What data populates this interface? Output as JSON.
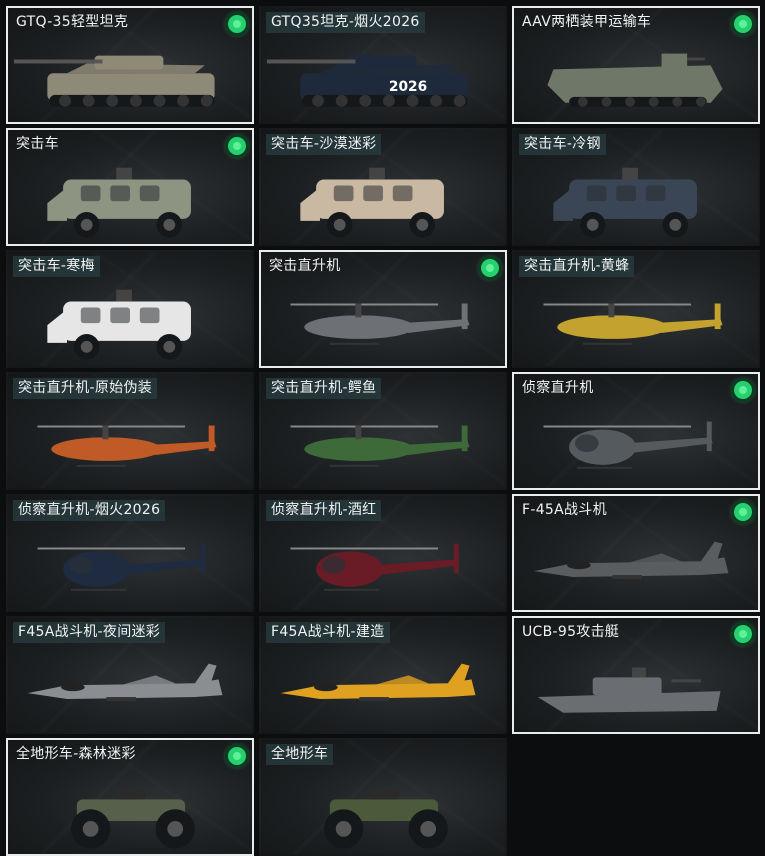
{
  "vehicles": [
    {
      "name": "GTQ-35轻型坦克",
      "owned": true,
      "icon": "tank-icon",
      "color": "#8f8a78"
    },
    {
      "name": "GTQ35坦克-烟火2026",
      "owned": false,
      "icon": "tank-icon",
      "color": "#1e2a3c",
      "decal": "2026"
    },
    {
      "name": "AAV两栖装甲运输车",
      "owned": true,
      "icon": "amphibious-vehicle-icon",
      "color": "#6f7868"
    },
    {
      "name": "突击车",
      "owned": true,
      "icon": "assault-vehicle-icon",
      "color": "#8d9482"
    },
    {
      "name": "突击车-沙漠迷彩",
      "owned": false,
      "icon": "assault-vehicle-icon",
      "color": "#c9b8a2"
    },
    {
      "name": "突击车-冷钢",
      "owned": false,
      "icon": "assault-vehicle-icon",
      "color": "#3a4656"
    },
    {
      "name": "突击车-寒梅",
      "owned": false,
      "icon": "assault-vehicle-icon",
      "color": "#e6e6e6"
    },
    {
      "name": "突击直升机",
      "owned": true,
      "icon": "attack-helicopter-icon",
      "color": "#6d7075"
    },
    {
      "name": "突击直升机-黄蜂",
      "owned": false,
      "icon": "attack-helicopter-icon",
      "color": "#c4a22f"
    },
    {
      "name": "突击直升机-原始伪装",
      "owned": false,
      "icon": "attack-helicopter-icon",
      "color": "#c05a26"
    },
    {
      "name": "突击直升机-鳄鱼",
      "owned": false,
      "icon": "attack-helicopter-icon",
      "color": "#3e6a3a"
    },
    {
      "name": "侦察直升机",
      "owned": true,
      "icon": "scout-helicopter-icon",
      "color": "#555a5e"
    },
    {
      "name": "侦察直升机-烟火2026",
      "owned": false,
      "icon": "scout-helicopter-icon",
      "color": "#1f2b40"
    },
    {
      "name": "侦察直升机-酒红",
      "owned": false,
      "icon": "scout-helicopter-icon",
      "color": "#6a1c26"
    },
    {
      "name": "F-45A战斗机",
      "owned": true,
      "icon": "fighter-jet-icon",
      "color": "#5a5d60"
    },
    {
      "name": "F45A战斗机-夜间迷彩",
      "owned": false,
      "icon": "fighter-jet-icon",
      "color": "#8a8d92"
    },
    {
      "name": "F45A战斗机-建造",
      "owned": false,
      "icon": "fighter-jet-icon",
      "color": "#e0a020"
    },
    {
      "name": "UCB-95攻击艇",
      "owned": true,
      "icon": "attack-boat-icon",
      "color": "#6a6e72"
    },
    {
      "name": "全地形车-森林迷彩",
      "owned": true,
      "icon": "atv-icon",
      "color": "#56604a"
    },
    {
      "name": "全地形车",
      "owned": false,
      "icon": "atv-icon",
      "color": "#4c5a3c"
    }
  ]
}
